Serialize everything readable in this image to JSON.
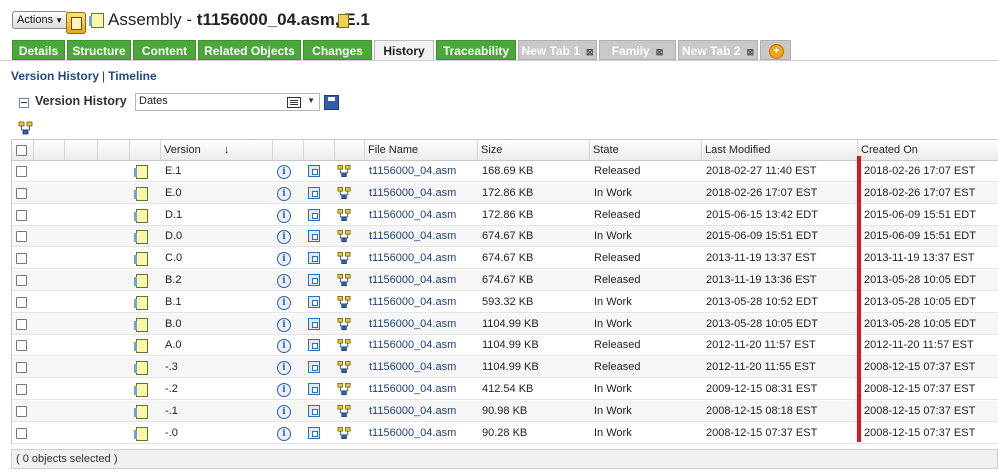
{
  "header": {
    "actions_label": "Actions",
    "object_type": "Assembly",
    "object_name": "t1156000_04.asm, E.1"
  },
  "tabs": [
    {
      "label": "Details",
      "style": "green"
    },
    {
      "label": "Structure",
      "style": "green"
    },
    {
      "label": "Content",
      "style": "green"
    },
    {
      "label": "Related Objects",
      "style": "green"
    },
    {
      "label": "Changes",
      "style": "green"
    },
    {
      "label": "History",
      "style": "active"
    },
    {
      "label": "Traceability",
      "style": "green"
    },
    {
      "label": "New Tab 1",
      "style": "grey"
    },
    {
      "label": "Family",
      "style": "grey"
    },
    {
      "label": "New Tab 2",
      "style": "grey"
    }
  ],
  "subnav": {
    "version_history": "Version History",
    "separator": "|",
    "timeline": "Timeline"
  },
  "version_history": {
    "title": "Version History",
    "view_select": "Dates"
  },
  "columns": {
    "version": "Version",
    "file_name": "File Name",
    "size": "Size",
    "state": "State",
    "last_modified": "Last Modified",
    "created_on": "Created On"
  },
  "rows": [
    {
      "version": "E.1",
      "file_name": "t1156000_04.asm",
      "size": "168.69 KB",
      "state": "Released",
      "last_modified": "2018-02-27 11:40 EST",
      "created_on": "2018-02-26 17:07 EST"
    },
    {
      "version": "E.0",
      "file_name": "t1156000_04.asm",
      "size": "172.86 KB",
      "state": "In Work",
      "last_modified": "2018-02-26 17:07 EST",
      "created_on": "2018-02-26 17:07 EST"
    },
    {
      "version": "D.1",
      "file_name": "t1156000_04.asm",
      "size": "172.86 KB",
      "state": "Released",
      "last_modified": "2015-06-15 13:42 EDT",
      "created_on": "2015-06-09 15:51 EDT"
    },
    {
      "version": "D.0",
      "file_name": "t1156000_04.asm",
      "size": "674.67 KB",
      "state": "In Work",
      "last_modified": "2015-06-09 15:51 EDT",
      "created_on": "2015-06-09 15:51 EDT"
    },
    {
      "version": "C.0",
      "file_name": "t1156000_04.asm",
      "size": "674.67 KB",
      "state": "Released",
      "last_modified": "2013-11-19 13:37 EST",
      "created_on": "2013-11-19 13:37 EST"
    },
    {
      "version": "B.2",
      "file_name": "t1156000_04.asm",
      "size": "674.67 KB",
      "state": "Released",
      "last_modified": "2013-11-19 13:36 EST",
      "created_on": "2013-05-28 10:05 EDT"
    },
    {
      "version": "B.1",
      "file_name": "t1156000_04.asm",
      "size": "593.32 KB",
      "state": "In Work",
      "last_modified": "2013-05-28 10:52 EDT",
      "created_on": "2013-05-28 10:05 EDT"
    },
    {
      "version": "B.0",
      "file_name": "t1156000_04.asm",
      "size": "1104.99 KB",
      "state": "In Work",
      "last_modified": "2013-05-28 10:05 EDT",
      "created_on": "2013-05-28 10:05 EDT"
    },
    {
      "version": "A.0",
      "file_name": "t1156000_04.asm",
      "size": "1104.99 KB",
      "state": "Released",
      "last_modified": "2012-11-20 11:57 EST",
      "created_on": "2012-11-20 11:57 EST"
    },
    {
      "version": "-.3",
      "file_name": "t1156000_04.asm",
      "size": "1104.99 KB",
      "state": "Released",
      "last_modified": "2012-11-20 11:55 EST",
      "created_on": "2008-12-15 07:37 EST"
    },
    {
      "version": "-.2",
      "file_name": "t1156000_04.asm",
      "size": "412.54 KB",
      "state": "In Work",
      "last_modified": "2009-12-15 08:31 EST",
      "created_on": "2008-12-15 07:37 EST"
    },
    {
      "version": "-.1",
      "file_name": "t1156000_04.asm",
      "size": "90.98 KB",
      "state": "In Work",
      "last_modified": "2008-12-15 08:18 EST",
      "created_on": "2008-12-15 07:37 EST"
    },
    {
      "version": "-.0",
      "file_name": "t1156000_04.asm",
      "size": "90.28 KB",
      "state": "In Work",
      "last_modified": "2008-12-15 07:37 EST",
      "created_on": "2008-12-15 07:37 EST"
    }
  ],
  "status": {
    "selected_text": "( 0 objects selected )"
  },
  "colors": {
    "tab_green": "#4aa83a",
    "tab_grey": "#c8c8c8",
    "highlight_red": "#e0141c",
    "link_blue": "#1f3f78"
  }
}
